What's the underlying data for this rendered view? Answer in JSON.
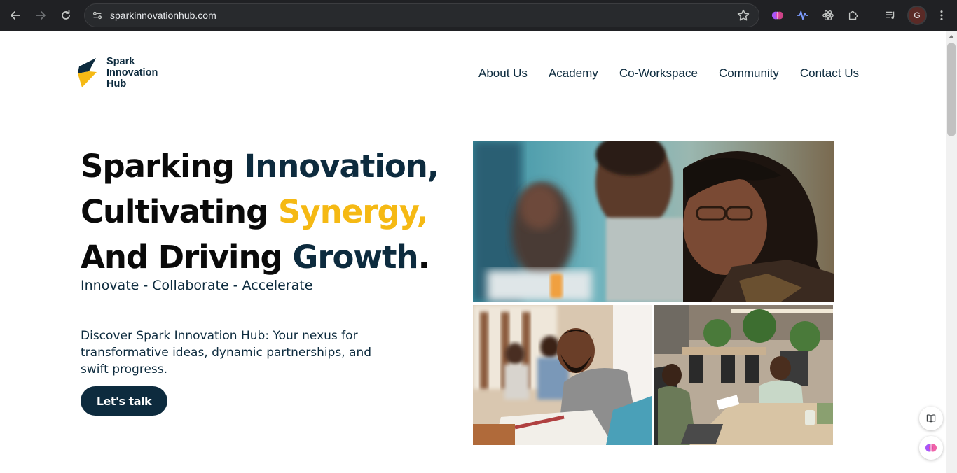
{
  "browser": {
    "url": "sparkinnovationhub.com",
    "profile_initial": "G",
    "icons": [
      "back-icon",
      "forward-icon",
      "reload-icon",
      "site-settings-icon",
      "bookmark-star-icon",
      "brain-extension-icon",
      "waveform-extension-icon",
      "atom-extension-icon",
      "extensions-puzzle-icon",
      "media-controls-icon",
      "menu-dots-icon"
    ]
  },
  "header": {
    "logo_lines": [
      "Spark",
      "Innovation",
      "Hub"
    ],
    "nav": [
      "About Us",
      "Academy",
      "Co-Workspace",
      "Community",
      "Contact Us"
    ]
  },
  "hero": {
    "line1_a": "Sparking ",
    "line1_b": "Innovation,",
    "line2_a": "Cultivating ",
    "line2_b": "Synergy,",
    "line3_a": "And Driving ",
    "line3_b": "Growth",
    "line3_c": ".",
    "tagline": "Innovate - Collaborate - Accelerate",
    "description": "Discover Spark Innovation Hub: Your nexus for transformative ideas, dynamic partnerships, and swift progress.",
    "cta_label": "Let's talk"
  },
  "colors": {
    "navy": "#0d2b3e",
    "gold": "#f5b914",
    "chrome_bg": "#202124"
  }
}
